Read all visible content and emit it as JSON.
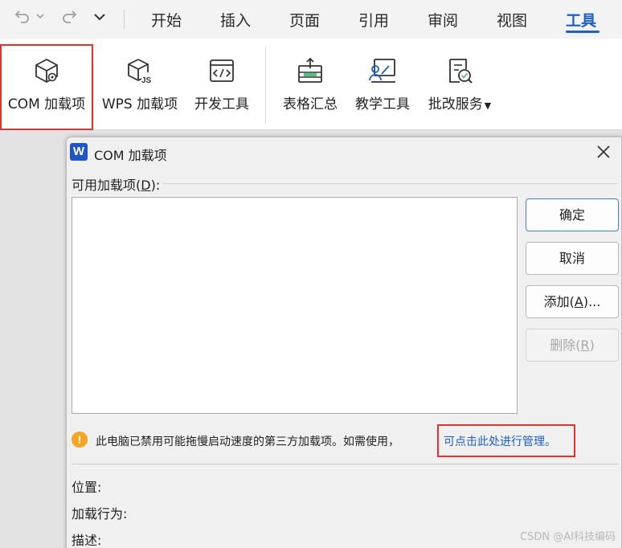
{
  "menubar": {
    "tabs": [
      "开始",
      "插入",
      "页面",
      "引用",
      "审阅",
      "视图",
      "工具"
    ],
    "active_tab": "工具"
  },
  "ribbon": {
    "buttons": [
      {
        "label": "COM 加载项",
        "icon": "com-addin-icon"
      },
      {
        "label": "WPS 加载项",
        "icon": "wps-addin-icon"
      },
      {
        "label": "开发工具",
        "icon": "developer-tools-icon"
      },
      {
        "label": "表格汇总",
        "icon": "table-summary-icon"
      },
      {
        "label": "教学工具",
        "icon": "teaching-tools-icon"
      },
      {
        "label": "批改服务",
        "icon": "grading-service-icon"
      }
    ],
    "highlight_color": "#e0322f"
  },
  "dialog": {
    "logo": "W",
    "title": "COM 加载项",
    "available_label_pre": "可用加载项(",
    "available_label_key": "D",
    "available_label_post": "):",
    "ok_label": "确定",
    "cancel_label": "取消",
    "add_label_pre": "添加(",
    "add_label_key": "A",
    "add_label_post": ")...",
    "remove_label_pre": "删除(",
    "remove_label_key": "R",
    "remove_label_post": ")",
    "warning_icon": "!",
    "warning_text": "此电脑已禁用可能拖慢启动速度的第三方加载项。如需使用，",
    "warning_link": "可点击此处进行管理。",
    "location_label": "位置:",
    "load_behavior_label": "加载行为:",
    "description_label": "描述:"
  },
  "watermark": "CSDN @AI科技编码",
  "colors": {
    "accent": "#1d5fc6",
    "highlight": "#e0322f",
    "warning": "#f5a623"
  }
}
